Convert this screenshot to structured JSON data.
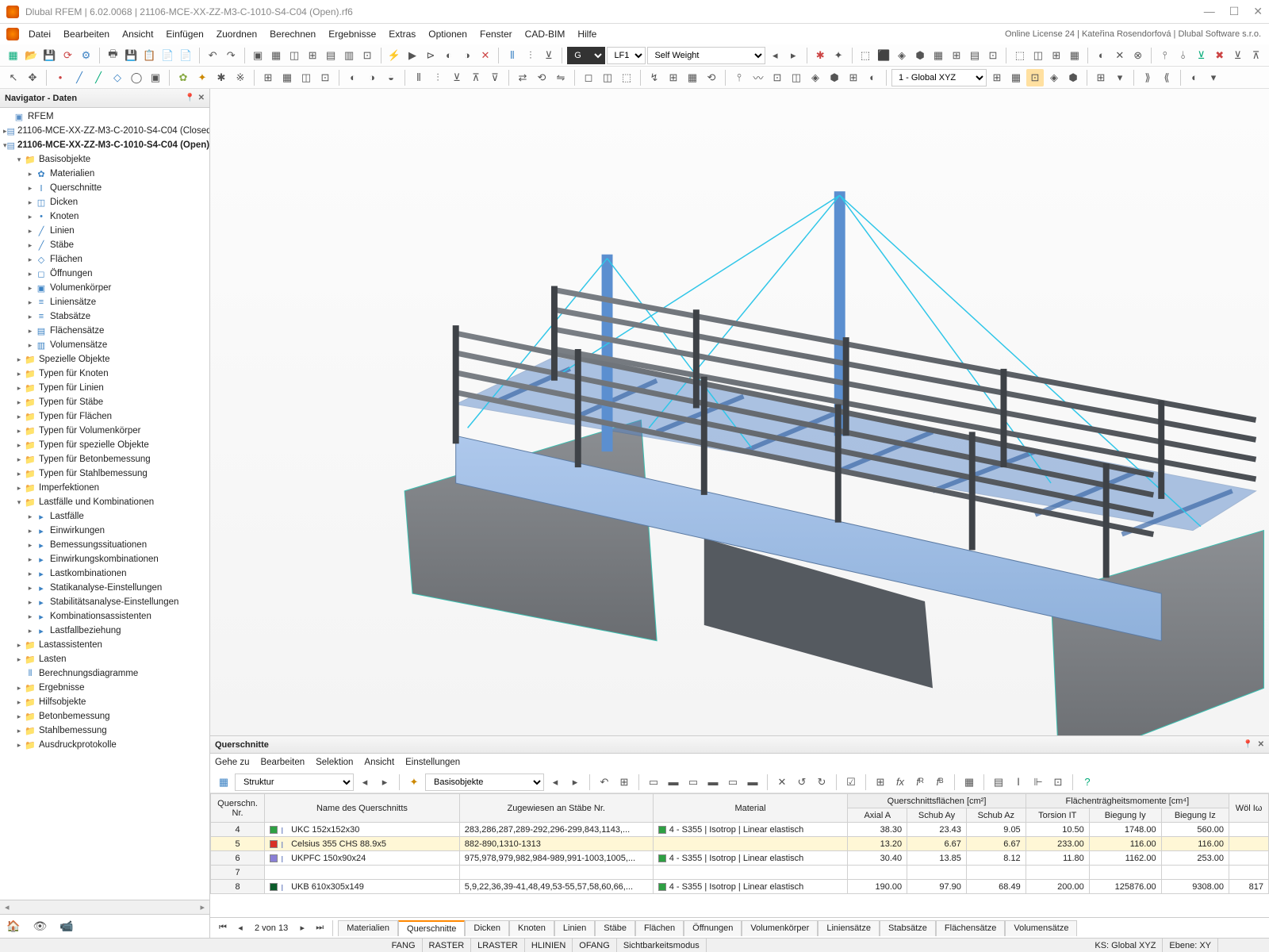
{
  "title": "Dlubal RFEM | 6.02.0068 | 21106-MCE-XX-ZZ-M3-C-1010-S4-C04 (Open).rf6",
  "menubar": {
    "items": [
      "Datei",
      "Bearbeiten",
      "Ansicht",
      "Einfügen",
      "Zuordnen",
      "Berechnen",
      "Ergebnisse",
      "Extras",
      "Optionen",
      "Fenster",
      "CAD-BIM",
      "Hilfe"
    ],
    "right_info": "Online License 24 | Kateřina Rosendorfová | Dlubal Software s.r.o."
  },
  "toolbar1": {
    "loadcase_label": "LF1",
    "loadcase_name": "Self Weight",
    "coord_sys": "1 - Global XYZ"
  },
  "navigator": {
    "title": "Navigator - Daten",
    "root": "RFEM",
    "models": [
      "21106-MCE-XX-ZZ-M3-C-2010-S4-C04 (Closed)",
      "21106-MCE-XX-ZZ-M3-C-1010-S4-C04 (Open)"
    ],
    "basis_label": "Basisobjekte",
    "basis_items": [
      "Materialien",
      "Querschnitte",
      "Dicken",
      "Knoten",
      "Linien",
      "Stäbe",
      "Flächen",
      "Öffnungen",
      "Volumenkörper",
      "Liniensätze",
      "Stabsätze",
      "Flächensätze",
      "Volumensätze"
    ],
    "mid_folders": [
      "Spezielle Objekte",
      "Typen für Knoten",
      "Typen für Linien",
      "Typen für Stäbe",
      "Typen für Flächen",
      "Typen für Volumenkörper",
      "Typen für spezielle Objekte",
      "Typen für Betonbemessung",
      "Typen für Stahlbemessung",
      "Imperfektionen"
    ],
    "loadcases_label": "Lastfälle und Kombinationen",
    "loadcases_items": [
      "Lastfälle",
      "Einwirkungen",
      "Bemessungssituationen",
      "Einwirkungskombinationen",
      "Lastkombinationen",
      "Statikanalyse-Einstellungen",
      "Stabilitätsanalyse-Einstellungen",
      "Kombinationsassistenten",
      "Lastfallbeziehung"
    ],
    "end_folders": [
      "Lastassistenten",
      "Lasten",
      "Berechnungsdiagramme",
      "Ergebnisse",
      "Hilfsobjekte",
      "Betonbemessung",
      "Stahlbemessung",
      "Ausdruckprotokolle"
    ]
  },
  "bottom_panel": {
    "title": "Querschnitte",
    "menu": [
      "Gehe zu",
      "Bearbeiten",
      "Selektion",
      "Ansicht",
      "Einstellungen"
    ],
    "combo1": "Struktur",
    "combo2": "Basisobjekte",
    "header_group1": "Querschnittsflächen [cm²]",
    "header_group2": "Flächenträgheitsmomente [cm⁴]",
    "columns": [
      "Querschn. Nr.",
      "Name des Querschnitts",
      "Zugewiesen an Stäbe Nr.",
      "Material",
      "Axial A",
      "Schub Ay",
      "Schub Az",
      "Torsion IT",
      "Biegung Iy",
      "Biegung Iz",
      "Wöl Iω"
    ],
    "rows": [
      {
        "nr": "4",
        "swatch": "#2ea043",
        "name": "UKC 152x152x30",
        "assigned": "283,286,287,289-292,296-299,843,1143,...",
        "material": "4 - S355 | Isotrop | Linear elastisch",
        "a": "38.30",
        "ay": "23.43",
        "az": "9.05",
        "it": "10.50",
        "iy": "1748.00",
        "iz": "560.00",
        "iw": ""
      },
      {
        "nr": "5",
        "swatch": "#d93025",
        "name": "Celsius 355 CHS 88.9x5",
        "assigned": "882-890,1310-1313",
        "material": "",
        "a": "13.20",
        "ay": "6.67",
        "az": "6.67",
        "it": "233.00",
        "iy": "116.00",
        "iz": "116.00",
        "iw": ""
      },
      {
        "nr": "6",
        "swatch": "#8a7fd6",
        "name": "UKPFC 150x90x24",
        "assigned": "975,978,979,982,984-989,991-1003,1005,...",
        "material": "4 - S355 | Isotrop | Linear elastisch",
        "a": "30.40",
        "ay": "13.85",
        "az": "8.12",
        "it": "11.80",
        "iy": "1162.00",
        "iz": "253.00",
        "iw": ""
      },
      {
        "nr": "7",
        "swatch": "",
        "name": "",
        "assigned": "",
        "material": "",
        "a": "",
        "ay": "",
        "az": "",
        "it": "",
        "iy": "",
        "iz": "",
        "iw": ""
      },
      {
        "nr": "8",
        "swatch": "#0b5b2a",
        "name": "UKB 610x305x149",
        "assigned": "5,9,22,36,39-41,48,49,53-55,57,58,60,66,...",
        "material": "4 - S355 | Isotrop | Linear elastisch",
        "a": "190.00",
        "ay": "97.90",
        "az": "68.49",
        "it": "200.00",
        "iy": "125876.00",
        "iz": "9308.00",
        "iw": "817"
      }
    ],
    "pager_text": "2 von 13",
    "tabs": [
      "Materialien",
      "Querschnitte",
      "Dicken",
      "Knoten",
      "Linien",
      "Stäbe",
      "Flächen",
      "Öffnungen",
      "Volumenkörper",
      "Liniensätze",
      "Stabsätze",
      "Flächensätze",
      "Volumensätze"
    ],
    "active_tab": 1
  },
  "statusbar": {
    "items": [
      "FANG",
      "RASTER",
      "LRASTER",
      "HLINIEN",
      "OFANG",
      "Sichtbarkeitsmodus"
    ],
    "ks": "KS: Global XYZ",
    "ebene": "Ebene: XY"
  }
}
